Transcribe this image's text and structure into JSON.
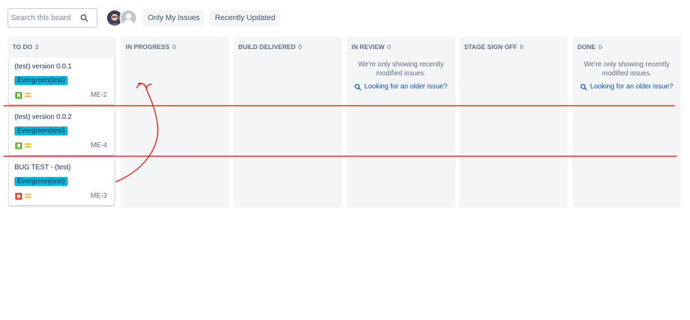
{
  "search": {
    "placeholder": "Search this board"
  },
  "filters": [
    {
      "label": "Only My Issues"
    },
    {
      "label": "Recently Updated"
    }
  ],
  "columns": [
    {
      "name": "TO DO",
      "count": "3"
    },
    {
      "name": "IN PROGRESS",
      "count": "0"
    },
    {
      "name": "BUILD DELIVERED",
      "count": "0"
    },
    {
      "name": "IN REVIEW",
      "count": "0",
      "message_line1": "We're only showing recently",
      "message_line2": "modified issues.",
      "link": "Looking for an older issue?"
    },
    {
      "name": "STAGE SIGN OFF",
      "count": "0"
    },
    {
      "name": "DONE",
      "count": "0",
      "message_line1": "We're only showing recently",
      "message_line2": "modified issues.",
      "link": "Looking for an older issue?"
    }
  ],
  "cards": [
    {
      "summary": "(test) version 0.0.1",
      "epic": "Evergreen(test)",
      "type": "story",
      "key": "ME-2"
    },
    {
      "summary": "(test) version 0.0.2",
      "epic": "Evergreen(test)",
      "type": "story",
      "key": "ME-4"
    },
    {
      "summary": "BUG TEST - (test)",
      "epic": "Evergreen(test)",
      "type": "bug",
      "key": "ME-3"
    }
  ],
  "colors": {
    "epic": "#00b8d9",
    "story": "#63ba3c",
    "bug": "#e5493a",
    "priority_medium": "#ffab00",
    "annotation": "#e0281b",
    "link": "#0052cc"
  },
  "icons": {
    "search": "search-icon",
    "story": "story-icon",
    "bug": "bug-icon",
    "priority": "priority-medium-icon"
  }
}
